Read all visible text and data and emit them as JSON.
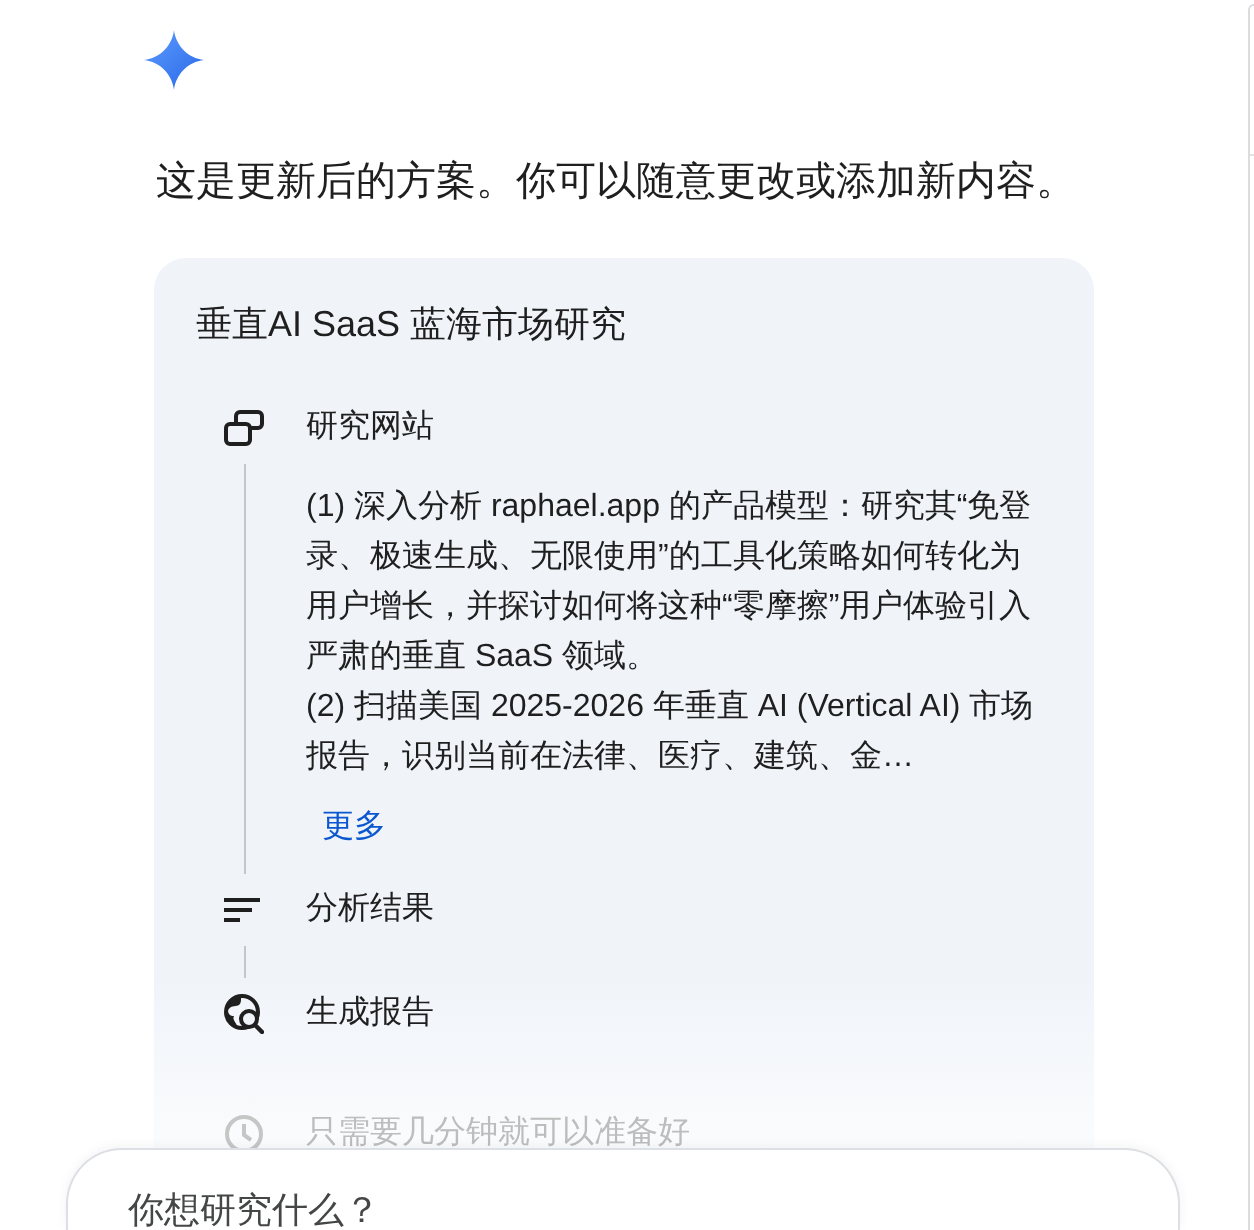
{
  "assistant_message": {
    "text": "这是更新后的方案。你可以随意更改或添加新内容。"
  },
  "plan_card": {
    "title": "垂直AI SaaS 蓝海市场研究",
    "steps": [
      {
        "label": "研究网站",
        "details": [
          "(1) 深入分析 raphael.app 的产品模型：研究其“免登录、极速生成、无限使用”的工具化策略如何转化为用户增长，并探讨如何将这种“零摩擦”用户体验引入严肃的垂直 SaaS 领域。",
          "(2) 扫描美国 2025-2026 年垂直 AI (Vertical AI) 市场报告，识别当前在法律、医疗、建筑、金…"
        ],
        "more_link": "更多"
      },
      {
        "label": "分析结果"
      },
      {
        "label": "生成报告"
      }
    ],
    "note": "只需要几分钟就可以准备好"
  },
  "prompt_input": {
    "placeholder": "你想研究什么？"
  }
}
